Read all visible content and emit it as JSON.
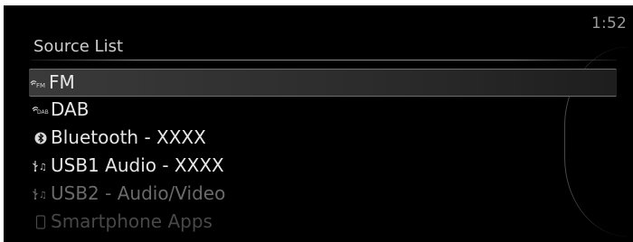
{
  "header": {
    "clock": "1:52"
  },
  "source_list": {
    "title": "Source List",
    "items": [
      {
        "label": "FM",
        "icon": "fm-radio-icon",
        "state": "selected"
      },
      {
        "label": "DAB",
        "icon": "dab-radio-icon",
        "state": "normal"
      },
      {
        "label": "Bluetooth - XXXX",
        "icon": "bluetooth-icon",
        "state": "normal"
      },
      {
        "label": "USB1 Audio - XXXX",
        "icon": "usb-audio-icon",
        "state": "normal"
      },
      {
        "label": "USB2 - Audio/Video",
        "icon": "usb-audio-icon",
        "state": "disabled"
      },
      {
        "label": "Smartphone Apps",
        "icon": "smartphone-icon",
        "state": "disabled"
      }
    ]
  },
  "colors": {
    "background": "#000000",
    "text": "#e6e6e6",
    "disabled_text": "#6a6a6a",
    "highlight": "#3a3a3a"
  }
}
